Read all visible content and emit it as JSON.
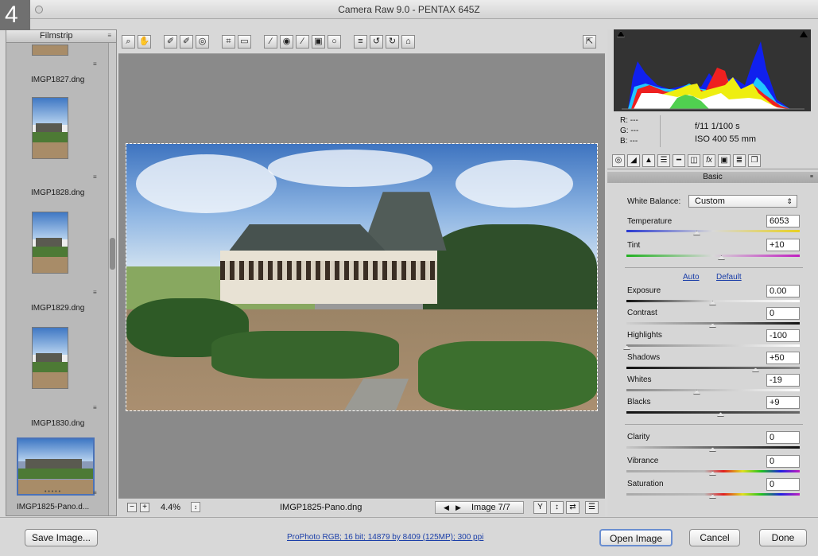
{
  "window": {
    "title": "Camera Raw 9.0  -  PENTAX 645Z",
    "step_badge": "4"
  },
  "filmstrip": {
    "title": "Filmstrip",
    "menu_icon": "≡",
    "items": [
      {
        "name": "IMGP1827.dng"
      },
      {
        "name": "IMGP1828.dng"
      },
      {
        "name": "IMGP1829.dng"
      },
      {
        "name": "IMGP1830.dng"
      },
      {
        "name": "IMGP1825-Pano.d...",
        "selected": true,
        "rating": "• • • • •"
      }
    ]
  },
  "toolbar": {
    "tools": [
      {
        "name": "zoom-tool",
        "glyph": "⌕"
      },
      {
        "name": "hand-tool",
        "glyph": "✋"
      },
      {
        "name": "white-balance-tool",
        "glyph": "✐"
      },
      {
        "name": "color-sampler-tool",
        "glyph": "✐"
      },
      {
        "name": "targeted-adjustment-tool",
        "glyph": "◎"
      },
      {
        "name": "crop-tool",
        "glyph": "⌗"
      },
      {
        "name": "straighten-tool",
        "glyph": "▭"
      },
      {
        "name": "spot-removal-tool",
        "glyph": "∕"
      },
      {
        "name": "red-eye-tool",
        "glyph": "◉"
      },
      {
        "name": "adjustment-brush-tool",
        "glyph": "∕"
      },
      {
        "name": "graduated-filter-tool",
        "glyph": "▣"
      },
      {
        "name": "radial-filter-tool",
        "glyph": "○"
      },
      {
        "name": "preferences-tool",
        "glyph": "≡"
      },
      {
        "name": "rotate-left-tool",
        "glyph": "↺"
      },
      {
        "name": "rotate-right-tool",
        "glyph": "↻"
      },
      {
        "name": "trash-tool",
        "glyph": "⌂"
      }
    ],
    "fullscreen_glyph": "⇱"
  },
  "image": {
    "file_name": "IMGP1825-Pano.dng",
    "counter": "Image 7/7"
  },
  "zoom": {
    "minus": "−",
    "plus": "+",
    "value": "4.4%",
    "dropdown_glyph": "↕"
  },
  "nav": {
    "prev": "◀",
    "next": "▶"
  },
  "view_buttons": {
    "compare": "Y",
    "cycle": "↕",
    "swap": "⇄",
    "settings": "☰"
  },
  "histogram": {
    "warn_left": "shadow-clipping-warning",
    "warn_right": "highlight-clipping-warning"
  },
  "info": {
    "r": "R:  ---",
    "g": "G:  ---",
    "b": "B:  ---",
    "aperture_shutter": "f/11   1/100 s",
    "iso_focal": "ISO 400   55 mm"
  },
  "panel_tabs": [
    "◎",
    "◢",
    "▲",
    "☰",
    "━",
    "◫",
    "fx",
    "▣",
    "≣",
    "❐"
  ],
  "panel": {
    "title": "Basic",
    "menu_icon": "≡",
    "white_balance_label": "White Balance:",
    "white_balance_value": "Custom",
    "auto": "Auto",
    "default": "Default",
    "sliders": {
      "temperature": {
        "label": "Temperature",
        "value": "6053"
      },
      "tint": {
        "label": "Tint",
        "value": "+10"
      },
      "exposure": {
        "label": "Exposure",
        "value": "0.00"
      },
      "contrast": {
        "label": "Contrast",
        "value": "0"
      },
      "highlights": {
        "label": "Highlights",
        "value": "-100"
      },
      "shadows": {
        "label": "Shadows",
        "value": "+50"
      },
      "whites": {
        "label": "Whites",
        "value": "-19"
      },
      "blacks": {
        "label": "Blacks",
        "value": "+9"
      },
      "clarity": {
        "label": "Clarity",
        "value": "0"
      },
      "vibrance": {
        "label": "Vibrance",
        "value": "0"
      },
      "saturation": {
        "label": "Saturation",
        "value": "0"
      }
    }
  },
  "footer": {
    "save": "Save Image...",
    "workflow_link": "ProPhoto RGB; 16 bit; 14879 by 8409 (125MP); 300 ppi",
    "open": "Open Image",
    "cancel": "Cancel",
    "done": "Done"
  },
  "colors": {
    "accent_link": "#1a3ea8",
    "selection": "#4a72b8"
  }
}
